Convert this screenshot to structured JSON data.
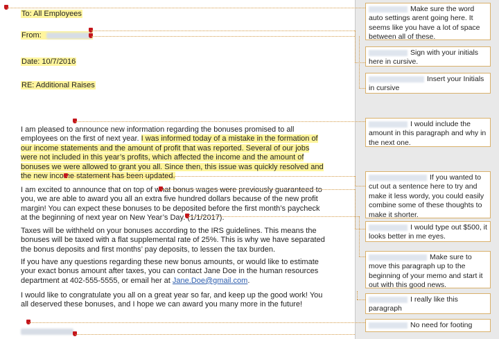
{
  "memo": {
    "to": "To: All Employees",
    "from_label": "From:",
    "date": "Date: 10/7/2016",
    "re": "RE: Additional Raises"
  },
  "paragraphs": {
    "p1_plain": "I am pleased to announce new information regarding the bonuses promised to all employees on the first of next year. ",
    "p1_highlight": "I was informed today of a mistake in the formation of our income statements and the amount of profit that was reported. Several of our jobs were not included in this year’s profits, which affected the income and the amount of bonuses we were allowed to grant you all. Since then, this issue was quickly resolved and the new income statement has been updated.",
    "p2": "I am excited to announce that on top of what bonus wages were previously guaranteed to you, we are able to award you all an extra five hundred dollars because of the new profit margin! You can expect these bonuses to be deposited before the first month’s paycheck at the beginning of next year on New Year’s Day. (1/1/2017).",
    "p3": "Taxes will be withheld on your bonuses according to the IRS guidelines. This means the bonuses will be taxed with a flat supplemental rate of 25%. This is why we have separated the bonus deposits and first months’ pay deposits, to lessen the tax burden.",
    "p4_before": "If you have any questions regarding these new bonus amounts, or would like to estimate your exact bonus amount after taxes, you can contact Jane Doe in the human resources department at 402-555-5555, or email her at ",
    "p4_email": "Jane.Doe@gmail.com",
    "p4_after": ".",
    "p5": "I would like to congratulate you all on a great year so far, and keep up the good work! You all deserved these bonuses, and I hope we can award you many more in the future!"
  },
  "comments": [
    {
      "text": "Make sure the word auto settings arent going here. It seems like you have a lot of space between all of these."
    },
    {
      "text": "Sign with your initials here in cursive."
    },
    {
      "text": "Insert your Initials in cursive"
    },
    {
      "text": "I would include the amount in this paragraph and why in the next one."
    },
    {
      "text": "If you wanted to cut out a sentence here to try and make it less wordy, you could easily combine some of these thoughts to make it shorter."
    },
    {
      "text": "I would type out $500, it looks better in me eyes."
    },
    {
      "text": "Make sure to move this paragraph up to the beginning of your memo and start it out with this good news."
    },
    {
      "text": "I really like this paragraph"
    },
    {
      "text": "No need for footing"
    }
  ]
}
